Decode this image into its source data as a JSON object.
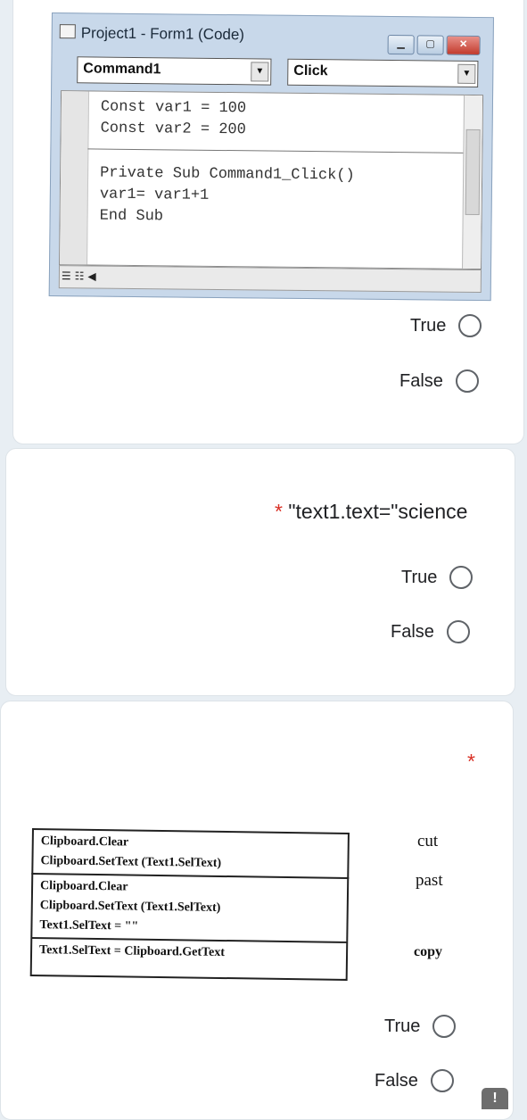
{
  "q1": {
    "code_window": {
      "title": "Project1 - Form1 (Code)",
      "object_combo": "Command1",
      "event_combo": "Click",
      "lines": [
        "Const var1 = 100",
        "Const var2 = 200",
        "Private Sub Command1_Click()",
        "var1= var1+1",
        "End Sub"
      ]
    },
    "options": [
      "True",
      "False"
    ]
  },
  "q2": {
    "required_mark": "*",
    "title": "\"text1.text=\"science",
    "options": [
      "True",
      "False"
    ]
  },
  "q3": {
    "required_mark": "*",
    "table_rows": [
      [
        "Clipboard.Clear",
        "Clipboard.SetText  (Text1.SelText)"
      ],
      [
        "Clipboard.Clear",
        "Clipboard.SetText  (Text1.SelText)",
        "Text1.SelText = \"\""
      ],
      [
        "Text1.SelText = Clipboard.GetText"
      ]
    ],
    "words": [
      "cut",
      "past",
      "copy"
    ],
    "options": [
      "True",
      "False"
    ]
  },
  "feedback_icon": "!"
}
